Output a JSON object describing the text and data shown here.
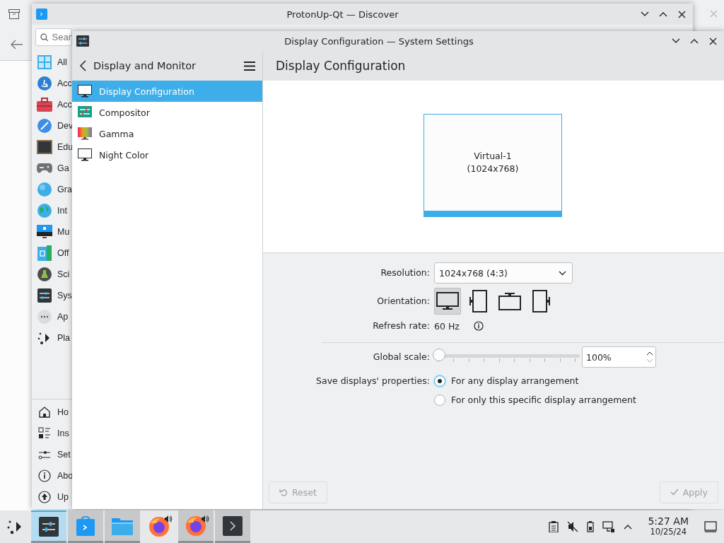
{
  "discover": {
    "title": "ProtonUp-Qt — Discover",
    "search": {
      "placeholder": "Sear"
    },
    "categories": [
      {
        "label": "All"
      },
      {
        "label": "Acc"
      },
      {
        "label": "Acc"
      },
      {
        "label": "Dev"
      },
      {
        "label": "Edu"
      },
      {
        "label": "Ga"
      },
      {
        "label": "Gra"
      },
      {
        "label": "Int"
      },
      {
        "label": "Mu"
      },
      {
        "label": "Off"
      },
      {
        "label": "Sci"
      },
      {
        "label": "Sys"
      },
      {
        "label": "Ap"
      },
      {
        "label": "Pla"
      }
    ],
    "actions": [
      {
        "label": "Ho"
      },
      {
        "label": "Ins"
      },
      {
        "label": "Set"
      },
      {
        "label": "Abo"
      },
      {
        "label": "Up"
      }
    ]
  },
  "settings": {
    "title": "Display Configuration — System Settings",
    "sidebar": {
      "title": "Display and Monitor",
      "items": [
        {
          "label": "Display Configuration",
          "selected": true
        },
        {
          "label": "Compositor",
          "selected": false
        },
        {
          "label": "Gamma",
          "selected": false
        },
        {
          "label": "Night Color",
          "selected": false
        }
      ]
    },
    "page_title": "Display Configuration",
    "output": {
      "name": "Virtual-1",
      "mode": "(1024x768)"
    },
    "resolution": {
      "label": "Resolution:",
      "value": "1024x768 (4:3)"
    },
    "orientation": {
      "label": "Orientation:",
      "options": [
        {
          "kind": "landscape",
          "selected": true
        },
        {
          "kind": "portrait-left",
          "selected": false
        },
        {
          "kind": "inverted",
          "selected": false
        },
        {
          "kind": "portrait-right",
          "selected": false
        }
      ]
    },
    "refresh": {
      "label": "Refresh rate:",
      "value": "60 Hz"
    },
    "scale": {
      "label": "Global scale:",
      "level": 0,
      "value": "100%"
    },
    "save": {
      "label": "Save displays' properties:",
      "options": [
        {
          "label": "For any display arrangement",
          "selected": true
        },
        {
          "label": "For only this specific display arrangement",
          "selected": false
        }
      ]
    },
    "buttons": [
      {
        "kind": "reset",
        "label": "Reset",
        "disabled": true
      },
      {
        "kind": "apply",
        "label": "Apply",
        "disabled": true
      }
    ]
  },
  "taskbar": {
    "tasks": [
      {
        "kind": "settings",
        "active": true,
        "open": true,
        "audio": false
      },
      {
        "kind": "discover",
        "active": false,
        "open": true,
        "audio": false
      },
      {
        "kind": "files",
        "active": false,
        "open": true,
        "audio": false
      },
      {
        "kind": "firefox",
        "active": false,
        "open": false,
        "audio": true
      },
      {
        "kind": "firefox",
        "active": false,
        "open": true,
        "audio": true
      },
      {
        "kind": "terminal",
        "active": false,
        "open": true,
        "audio": false
      }
    ],
    "time": "5:27 AM",
    "date": "10/25/24"
  }
}
